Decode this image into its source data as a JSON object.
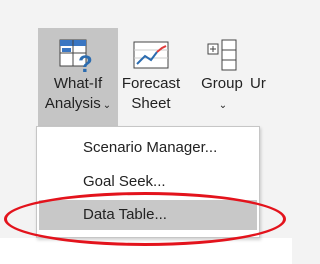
{
  "ribbon": {
    "buttons": [
      {
        "label_line1": "What-If",
        "label_line2": "Analysis",
        "icon": "what-if-icon",
        "state": "active"
      },
      {
        "label_line1": "Forecast",
        "label_line2": "Sheet",
        "icon": "forecast-sheet-icon"
      },
      {
        "label_line1": "Group",
        "label_line2": "",
        "icon": "group-icon"
      },
      {
        "label_line1": "Ur",
        "label_line2": "",
        "icon": "ungroup-icon"
      }
    ]
  },
  "menu": {
    "items": [
      {
        "label": "Scenario Manager..."
      },
      {
        "label": "Goal Seek..."
      },
      {
        "label": "Data Table..."
      }
    ]
  },
  "annotation": {
    "color": "#e3131c",
    "shape": "ellipse"
  },
  "colors": {
    "ribbon_bg": "#f3f3f3",
    "active_bg": "#c5c5c5",
    "menu_highlight": "#c8c8c8",
    "accent_blue": "#2b6cb0"
  }
}
